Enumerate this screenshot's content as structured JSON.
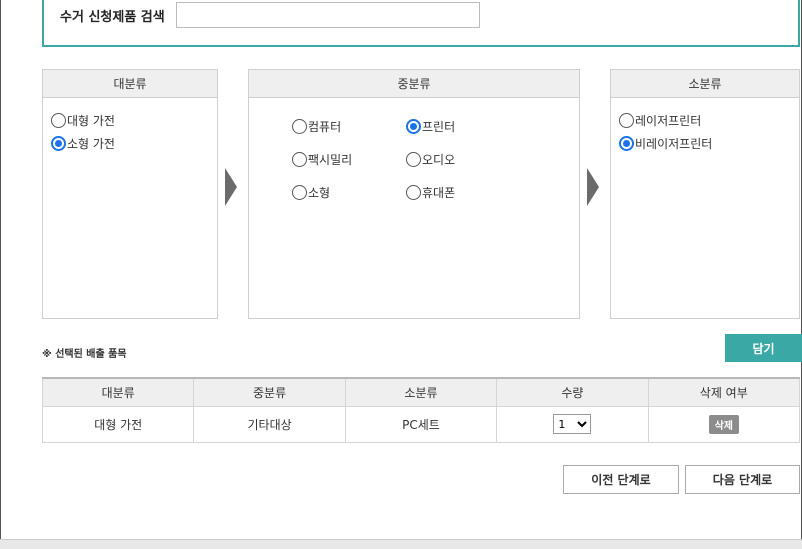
{
  "search": {
    "label": "수거 신청제품 검색",
    "value": "",
    "placeholder": ""
  },
  "categories": {
    "large": {
      "title": "대분류",
      "options": [
        {
          "label": "대형 가전",
          "checked": false
        },
        {
          "label": "소형 가전",
          "checked": true
        }
      ]
    },
    "medium": {
      "title": "중분류",
      "options": [
        {
          "label": "컴퓨터",
          "checked": false
        },
        {
          "label": "프린터",
          "checked": true
        },
        {
          "label": "팩시밀리",
          "checked": false
        },
        {
          "label": "오디오",
          "checked": false
        },
        {
          "label": "소형",
          "checked": false
        },
        {
          "label": "휴대폰",
          "checked": false
        }
      ]
    },
    "small": {
      "title": "소분류",
      "options": [
        {
          "label": "레이저프린터",
          "checked": false
        },
        {
          "label": "비레이저프린터",
          "checked": true
        }
      ]
    }
  },
  "selection": {
    "note": "※ 선택된 배출 품목",
    "add_label": "담기",
    "headers": [
      "대분류",
      "중분류",
      "소분류",
      "수량",
      "삭제 여부"
    ],
    "rows": [
      {
        "large": "대형 가전",
        "medium": "기타대상",
        "small": "PC세트",
        "qty": "1",
        "delete_label": "삭제"
      }
    ]
  },
  "nav": {
    "prev_label": "이전 단계로",
    "next_label": "다음 단계로"
  },
  "colors": {
    "accent": "#3aa8a4",
    "radio_checked": "#1a73e8"
  }
}
